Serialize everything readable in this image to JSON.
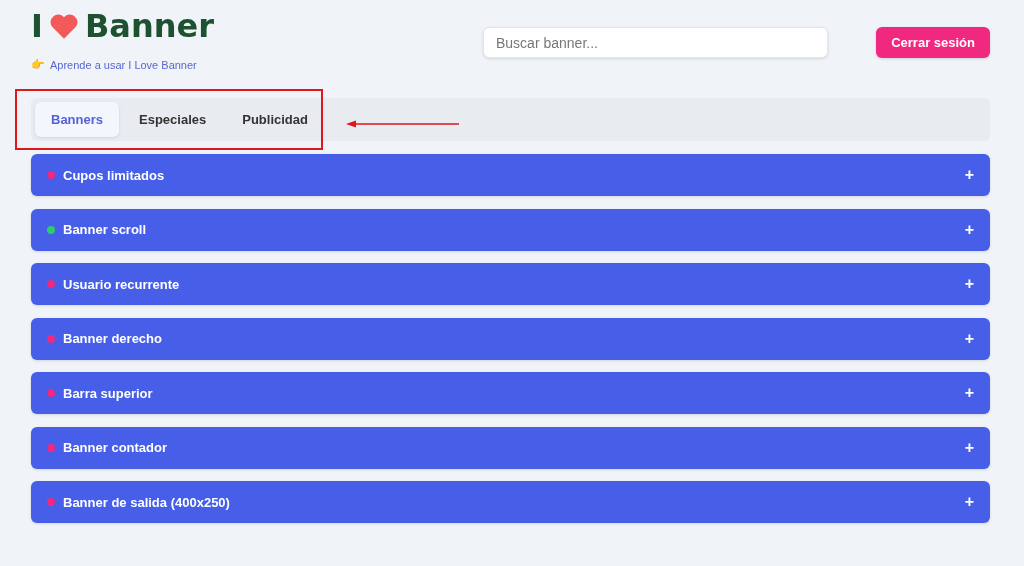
{
  "header": {
    "logo": {
      "left": "I",
      "right": "Banner"
    },
    "help_link": {
      "emoji": "👉",
      "text": "Aprende a usar I Love Banner"
    },
    "search": {
      "placeholder": "Buscar banner..."
    },
    "logout_button": "Cerrar sesión"
  },
  "tabs": [
    {
      "label": "Banners",
      "selected": true
    },
    {
      "label": "Especiales",
      "selected": false
    },
    {
      "label": "Publicidad",
      "selected": false
    }
  ],
  "banners": [
    {
      "name": "Cupos limitados",
      "color": "#f0287f",
      "expand": "+"
    },
    {
      "name": "Banner scroll",
      "color": "#2ecc71",
      "expand": "+"
    },
    {
      "name": "Usuario recurrente",
      "color": "#f0287f",
      "expand": "+"
    },
    {
      "name": "Banner derecho",
      "color": "#f0287f",
      "expand": "+"
    },
    {
      "name": "Barra superior",
      "color": "#f0287f",
      "expand": "+"
    },
    {
      "name": "Banner contador",
      "color": "#f0287f",
      "expand": "+"
    },
    {
      "name": "Banner de salida (400x250)",
      "color": "#f0287f",
      "expand": "+"
    }
  ]
}
